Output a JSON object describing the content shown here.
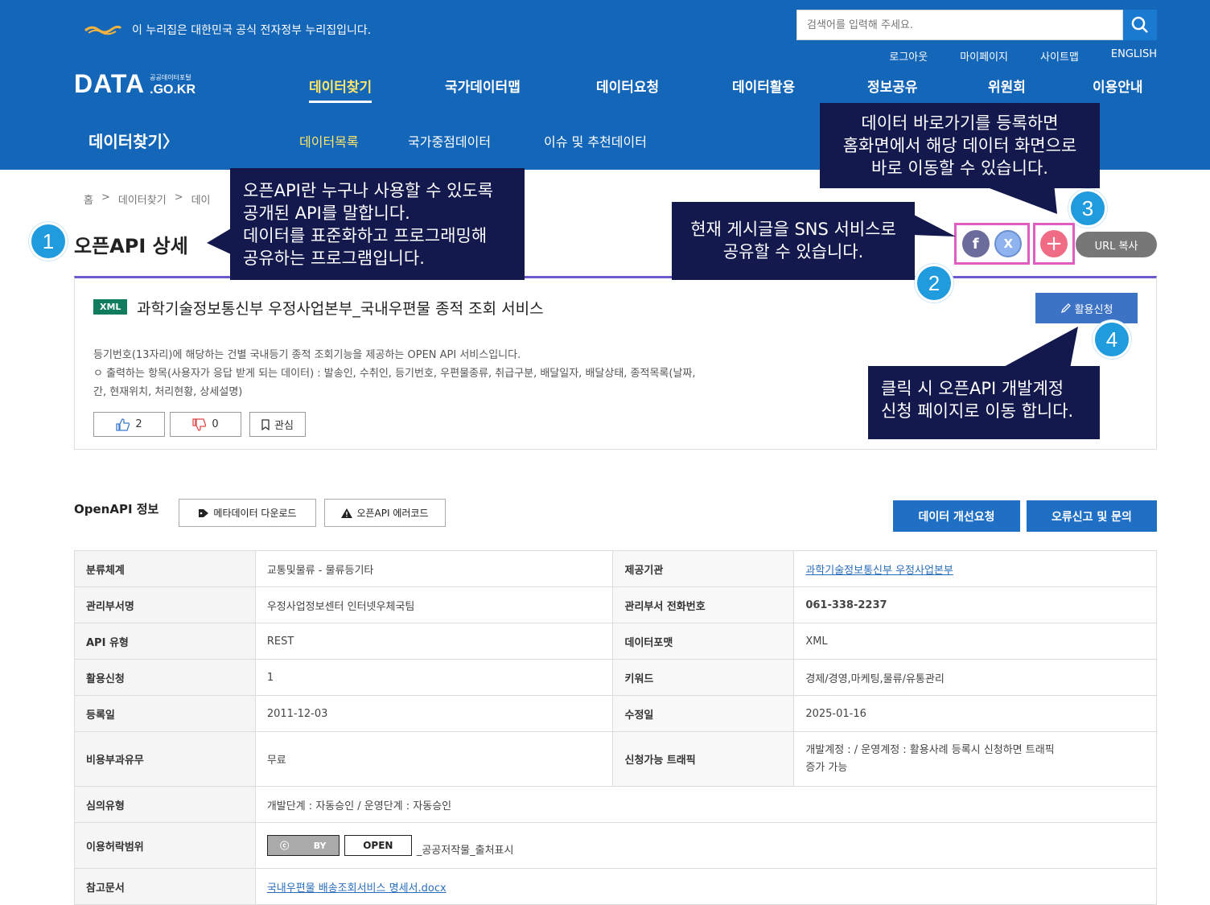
{
  "header": {
    "gov_notice": "이 누리집은 대한민국 공식 전자정부 누리집입니다.",
    "search_placeholder": "검색어를 입력해 주세요.",
    "util_links": [
      "로그아웃",
      "마이페이지",
      "사이트맵",
      "ENGLISH"
    ],
    "logo_main": "DATA",
    "logo_sub_small": "공공데이터포털",
    "logo_sub_big": ".GO.KR",
    "gnb": [
      "데이터찾기",
      "국가데이터맵",
      "데이터요청",
      "데이터활용",
      "정보공유",
      "위원회",
      "이용안내"
    ],
    "sub_title": "데이터찾기〉",
    "lnb": [
      "데이터목록",
      "국가중점데이터",
      "이슈 및 추천데이터"
    ],
    "colors": {
      "header_bg": "#1466b8",
      "active_menu": "#ffe66a"
    }
  },
  "breadcrumb": [
    "홈",
    "데이터찾기",
    "데이"
  ],
  "page_title": "오픈API 상세",
  "callouts": {
    "c1": [
      "오픈API란 누구나 사용할 수 있도록",
      "공개된 API를 말합니다.",
      "데이터를 표준화하고 프로그래밍해",
      "공유하는 프로그램입니다."
    ],
    "c2": [
      "현재 게시글을 SNS 서비스로",
      "공유할 수 있습니다."
    ],
    "c3": [
      "데이터 바로가기를 등록하면",
      "홈화면에서 해당 데이터 화면으로",
      "바로 이동할 수 있습니다."
    ],
    "c4": [
      "클릭 시 오픈API 개발계정",
      "신청 페이지로 이동 합니다."
    ]
  },
  "markers": [
    "1",
    "2",
    "3",
    "4"
  ],
  "share": {
    "url_copy": "URL 복사",
    "facebook_icon": "f",
    "x_icon": "X",
    "plus_icon": "+"
  },
  "detail": {
    "badge": "XML",
    "title": "과학기술정보통신부 우정사업본부_국내우편물 종적 조회 서비스",
    "apply_label": "활용신청",
    "desc_lines": [
      "등기번호(13자리)에 해당하는 건별 국내등기 종적 조회기능을 제공하는 OPEN API 서비스입니다.",
      "ㅇ 출력하는 항목(사용자가 응답 받게 되는 데이터) : 발송인, 수취인, 등기번호, 우편물종류, 취급구분, 배달일자, 배달상태, 종적목록(날짜,",
      "간, 현재위치, 처리현황, 상세설명)"
    ],
    "like_count": "2",
    "dislike_count": "0",
    "interest_label": "관심"
  },
  "openapi": {
    "label": "OpenAPI 정보",
    "meta_download": "메타데이터 다운로드",
    "error_code": "오픈API 에러코드",
    "improve_request": "데이터 개선요청",
    "report": "오류신고 및 문의"
  },
  "info_table": {
    "r1": {
      "k1": "분류체계",
      "v1": "교통및물류 - 물류등기타",
      "k2": "제공기관",
      "v2": "과학기술정보통신부 우정사업본부"
    },
    "r2": {
      "k1": "관리부서명",
      "v1": "우정사업정보센터 인터넷우체국팀",
      "k2": "관리부서 전화번호",
      "v2": "061-338-2237"
    },
    "r3": {
      "k1": "API 유형",
      "v1": "REST",
      "k2": "데이터포맷",
      "v2": "XML"
    },
    "r4": {
      "k1": "활용신청",
      "v1": "1",
      "k2": "키워드",
      "v2": "경제/경영,마케팅,물류/유통관리"
    },
    "r5": {
      "k1": "등록일",
      "v1": "2011-12-03",
      "k2": "수정일",
      "v2": "2025-01-16"
    },
    "r6": {
      "k1": "비용부과유무",
      "v1": "무료",
      "k2": "신청가능 트래픽",
      "v2a": "개발계정 : / 운영계정 : 활용사례 등록시 신청하면 트래픽",
      "v2b": "증가 가능"
    },
    "r7": {
      "k1": "심의유형",
      "v1": "개발단계 : 자동승인 / 운영단계 : 자동승인"
    },
    "r8": {
      "k1": "이용허락범위",
      "v1": "_공공저작물_출처표시",
      "cc_text": "BY",
      "open_text": "OPEN"
    },
    "r9": {
      "k1": "참고문서",
      "v1": "국내우편물 배송조회서비스 명세서.docx"
    }
  }
}
